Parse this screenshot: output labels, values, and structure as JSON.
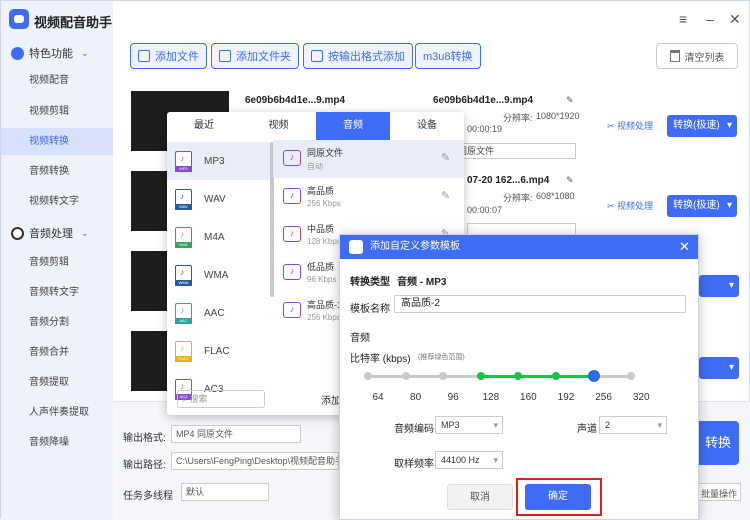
{
  "app": {
    "title": "视频配音助手"
  },
  "sidebar": {
    "section1": "特色功能",
    "items1": [
      "视频配音",
      "视频剪辑",
      "视频转换",
      "音频转换",
      "视频转文字"
    ],
    "section2": "音频处理",
    "items2": [
      "音频剪辑",
      "音频转文字",
      "音频分割",
      "音频合并",
      "音频提取",
      "人声伴奏提取",
      "音频降噪"
    ],
    "active": "视频转换"
  },
  "toolbar": {
    "add_file": "添加文件",
    "add_folder": "添加文件夹",
    "add_by_format": "按输出格式添加",
    "m3u8": "m3u8转换",
    "clear": "清空列表"
  },
  "files": [
    {
      "name": "6e09b6b4d1e...9.mp4",
      "out_name": "6e09b6b4d1e...9.mp4",
      "duration": "00:00:19",
      "res_label": "分辨率:",
      "res": "1080*1920",
      "format": "MP4  同原文件"
    },
    {
      "name": "07-20 162...6.mp4",
      "duration": "00:00:07",
      "res_label": "分辨率:",
      "res": "608*1080"
    }
  ],
  "row_actions": {
    "process": "视频处理",
    "convert": "转换(极速)"
  },
  "bottom": {
    "format_label": "输出格式:",
    "format_value": "MP4  同原文件",
    "path_label": "输出路径:",
    "path_value": "C:\\Users\\FengPing\\Desktop\\视频配音助手",
    "threads_label": "任务多线程",
    "threads_value": "默认",
    "start": "转换",
    "batch": "批量操作"
  },
  "format_popup": {
    "tabs": [
      "最近",
      "视频",
      "音频",
      "设备"
    ],
    "active_tab": "音频",
    "formats": [
      {
        "label": "MP3",
        "color": "#8e44d4"
      },
      {
        "label": "WAV",
        "color": "#2c5aa0"
      },
      {
        "label": "M4A",
        "color": "#2aa866"
      },
      {
        "label": "WMA",
        "color": "#2c5aa0"
      },
      {
        "label": "AAC",
        "color": "#27a5a0"
      },
      {
        "label": "FLAC",
        "color": "#e8b020"
      },
      {
        "label": "AC3",
        "color": "#8e44d4"
      }
    ],
    "qualities": [
      {
        "name": "同原文件",
        "sub": "自动"
      },
      {
        "name": "高品质",
        "sub": "256 Kbps"
      },
      {
        "name": "中品质",
        "sub": "128 Kbps"
      },
      {
        "name": "低品质",
        "sub": "96 Kbps"
      },
      {
        "name": "高品质-1",
        "sub": "256 Kbps"
      }
    ],
    "search_placeholder": "搜索",
    "add": "添加"
  },
  "dialog": {
    "title": "添加自定义参数模板",
    "type_label": "转换类型",
    "type_value": "音频 - MP3",
    "name_label": "模板名称",
    "name_value": "高品质-2",
    "audio_section": "音频",
    "bitrate_label": "比特率 (kbps)",
    "bitrate_hint": "(推荐绿色范围)",
    "bitrate_ticks": [
      "64",
      "80",
      "96",
      "128",
      "160",
      "192",
      "256",
      "320"
    ],
    "bitrate_selected": "256",
    "recommended_range": [
      "128",
      "256"
    ],
    "codec_label": "音频编码",
    "codec_value": "MP3",
    "channel_label": "声道",
    "channel_value": "2",
    "sample_label": "取样频率",
    "sample_value": "44100 Hz",
    "cancel": "取消",
    "confirm": "确定"
  },
  "colors": {
    "accent": "#3f6cf4",
    "green": "#19c24a",
    "highlight": "#e02020"
  }
}
